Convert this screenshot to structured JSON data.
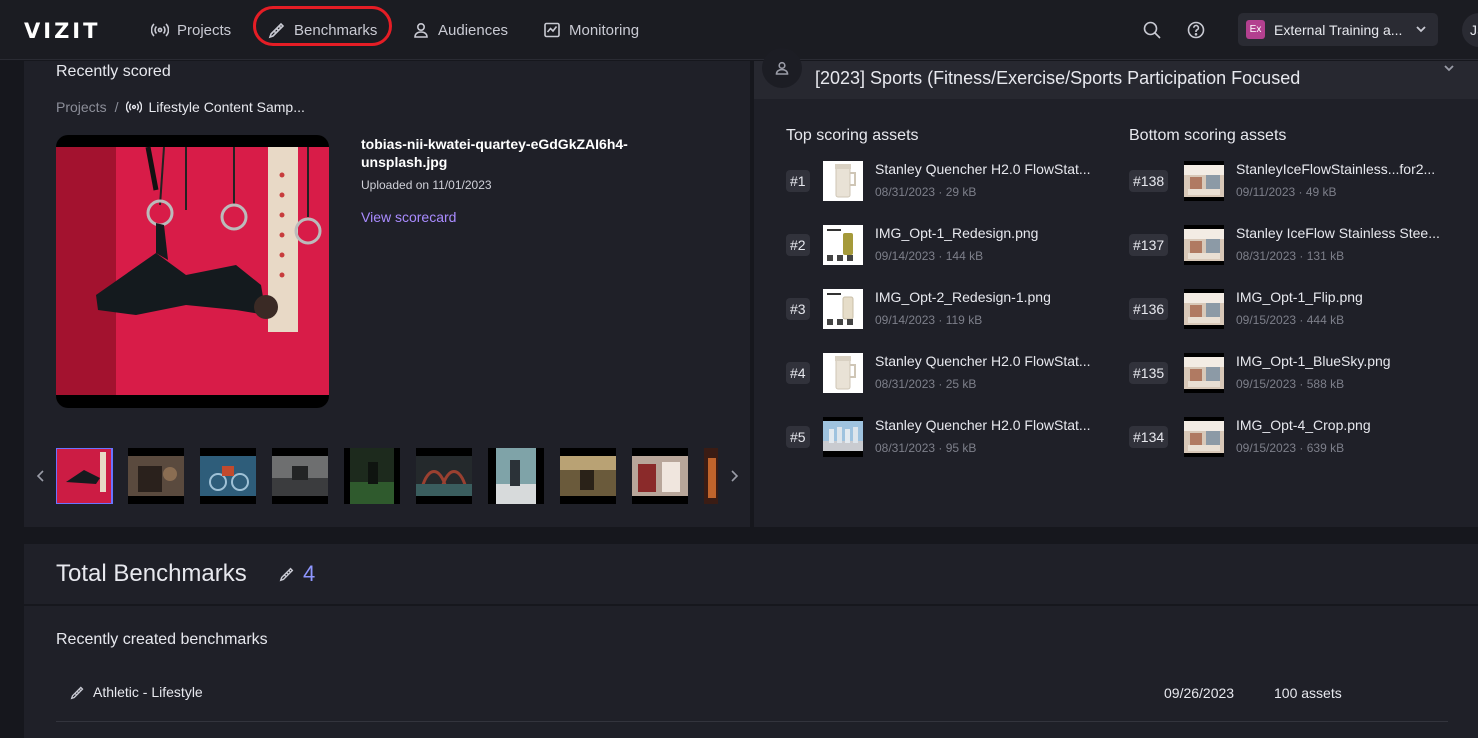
{
  "nav": {
    "logo": "VIZIT",
    "items": [
      {
        "label": "Projects"
      },
      {
        "label": "Benchmarks"
      },
      {
        "label": "Audiences"
      },
      {
        "label": "Monitoring"
      }
    ],
    "workspace": {
      "badge": "Ex",
      "name": "External Training a..."
    },
    "user_initials": "JS"
  },
  "recent": {
    "title": "Recently scored",
    "breadcrumb": {
      "root": "Projects",
      "separator": "/",
      "current": "Lifestyle Content Samp..."
    },
    "asset_name": "tobias-nii-kwatei-quartey-eGdGkZAI6h4-unsplash.jpg",
    "uploaded": "Uploaded on 11/01/2023",
    "view_link": "View scorecard"
  },
  "audience": {
    "title": "[2023] Sports (Fitness/Exercise/Sports Participation Focused",
    "top_title": "Top scoring assets",
    "bottom_title": "Bottom scoring assets",
    "top": [
      {
        "rank": "#1",
        "name": "Stanley Quencher H2.0 FlowStat...",
        "date": "08/31/2023",
        "size": "29 kB",
        "thumb": "tumbler"
      },
      {
        "rank": "#2",
        "name": "IMG_Opt-1_Redesign.png",
        "date": "09/14/2023",
        "size": "144 kB",
        "thumb": "sheet-olive"
      },
      {
        "rank": "#3",
        "name": "IMG_Opt-2_Redesign-1.png",
        "date": "09/14/2023",
        "size": "119 kB",
        "thumb": "sheet-cream"
      },
      {
        "rank": "#4",
        "name": "Stanley Quencher H2.0 FlowStat...",
        "date": "08/31/2023",
        "size": "25 kB",
        "thumb": "tumbler"
      },
      {
        "rank": "#5",
        "name": "Stanley Quencher H2.0 FlowStat...",
        "date": "08/31/2023",
        "size": "95 kB",
        "thumb": "lineup"
      }
    ],
    "bottom": [
      {
        "rank": "#138",
        "name": "StanleyIceFlowStainless...for2...",
        "date": "09/11/2023",
        "size": "49 kB",
        "thumb": "lifestyle"
      },
      {
        "rank": "#137",
        "name": "Stanley IceFlow Stainless Stee...",
        "date": "08/31/2023",
        "size": "131 kB",
        "thumb": "lifestyle"
      },
      {
        "rank": "#136",
        "name": "IMG_Opt-1_Flip.png",
        "date": "09/15/2023",
        "size": "444 kB",
        "thumb": "lifestyle"
      },
      {
        "rank": "#135",
        "name": "IMG_Opt-1_BlueSky.png",
        "date": "09/15/2023",
        "size": "588 kB",
        "thumb": "lifestyle"
      },
      {
        "rank": "#134",
        "name": "IMG_Opt-4_Crop.png",
        "date": "09/15/2023",
        "size": "639 kB",
        "thumb": "lifestyle"
      }
    ]
  },
  "benchmarks": {
    "title": "Total Benchmarks",
    "count": "4",
    "list_title": "Recently created benchmarks",
    "rows": [
      {
        "name": "Athletic - Lifestyle",
        "date": "09/26/2023",
        "assets": "100 assets"
      }
    ]
  },
  "colors": {
    "accent": "#a98bff",
    "count": "#8e96ff",
    "highlight": "#e51d25",
    "selected_thumb": "#6b73ff"
  }
}
